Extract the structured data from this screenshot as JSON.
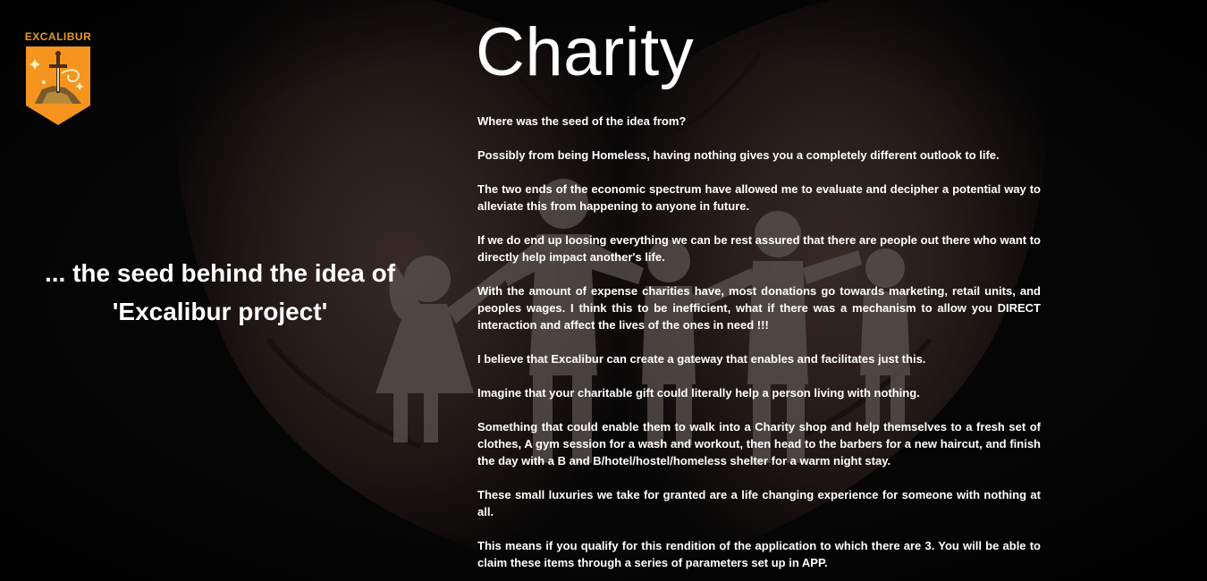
{
  "logo": {
    "text": "EXCALIBUR",
    "shield_color": "#f5941e",
    "icon": "sword-in-stone-icon"
  },
  "tagline": "... the seed behind the idea of 'Excalibur project'",
  "title": "Charity",
  "paragraphs": [
    "Where was the seed of the idea from?",
    "Possibly from being Homeless, having nothing gives you a completely different outlook to life.",
    "The two ends of the economic spectrum have allowed me to evaluate and decipher a potential way to alleviate this from happening to anyone in future.",
    "If we do end up loosing everything we can be rest assured that there are people out there who want to directly help impact another's life.",
    "With the amount of expense charities have, most donations go towards marketing, retail units, and peoples wages. I think this to be inefficient, what if there was a mechanism to allow you DIRECT interaction and affect the lives of the ones in need !!!",
    "I believe that Excalibur can create a gateway that enables and facilitates just  this.",
    "Imagine that  your charitable gift could literally help a person living with nothing.",
    "Something that could enable them to walk into a Charity shop and help themselves to a fresh set of clothes, A gym session for a wash and workout, then head to the barbers for a new haircut, and finish the day with a B and B/hotel/hostel/homeless shelter for a warm night stay.",
    "These small luxuries we take for granted are a life changing experience for someone with nothing at all.",
    "This means if you qualify for this rendition of the application to which there are 3. You will be able to claim these items through a series of parameters set up in APP."
  ],
  "background": {
    "image": "cupped-hands-paper-family-image",
    "overlay_color": "#000000"
  }
}
